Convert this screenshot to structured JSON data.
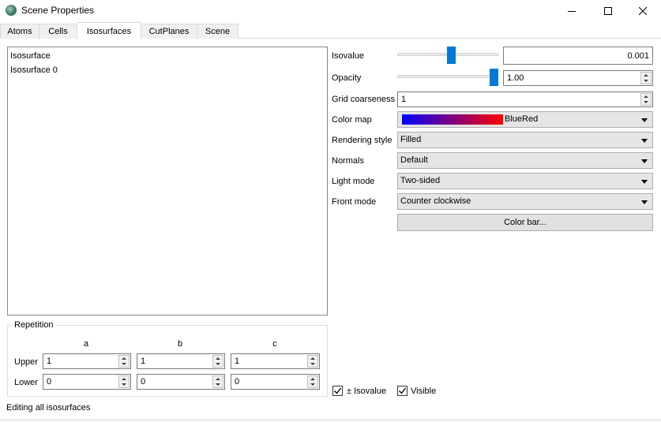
{
  "window": {
    "title": "Scene Properties",
    "minimize_icon": "minimize-icon",
    "maximize_icon": "maximize-icon",
    "close_icon": "close-icon"
  },
  "tabs": [
    {
      "label": "Atoms",
      "active": false
    },
    {
      "label": "Cells",
      "active": false
    },
    {
      "label": "Isosurfaces",
      "active": true
    },
    {
      "label": "CutPlanes",
      "active": false
    },
    {
      "label": "Scene",
      "active": false
    }
  ],
  "list": {
    "items": [
      "Isosurface",
      "Isosurface 0"
    ]
  },
  "repetition": {
    "title": "Repetition",
    "columns": [
      "a",
      "b",
      "c"
    ],
    "rows": [
      {
        "label": "Upper",
        "values": [
          "1",
          "1",
          "1"
        ]
      },
      {
        "label": "Lower",
        "values": [
          "0",
          "0",
          "0"
        ]
      }
    ]
  },
  "properties": {
    "isovalue": {
      "label": "Isovalue",
      "value": "0.001",
      "slider_fraction": 0.54
    },
    "opacity": {
      "label": "Opacity",
      "value": "1.00",
      "slider_fraction": 1.0
    },
    "grid_coarseness": {
      "label": "Grid coarseness",
      "value": "1"
    },
    "color_map": {
      "label": "Color map",
      "value": "BlueRed",
      "gradient_start": "#0000ff",
      "gradient_end": "#ff0000"
    },
    "rendering_style": {
      "label": "Rendering style",
      "value": "Filled"
    },
    "normals": {
      "label": "Normals",
      "value": "Default"
    },
    "light_mode": {
      "label": "Light mode",
      "value": "Two-sided"
    },
    "front_mode": {
      "label": "Front mode",
      "value": "Counter clockwise"
    },
    "color_bar_button": "Color bar..."
  },
  "options": {
    "pm_isovalue": {
      "label": "± Isovalue",
      "checked": true
    },
    "visible": {
      "label": "Visible",
      "checked": true
    }
  },
  "status": {
    "text": "Editing all isosurfaces"
  },
  "colors": {
    "accent": "#0078d7",
    "combo_bg": "#e5e5e5"
  }
}
